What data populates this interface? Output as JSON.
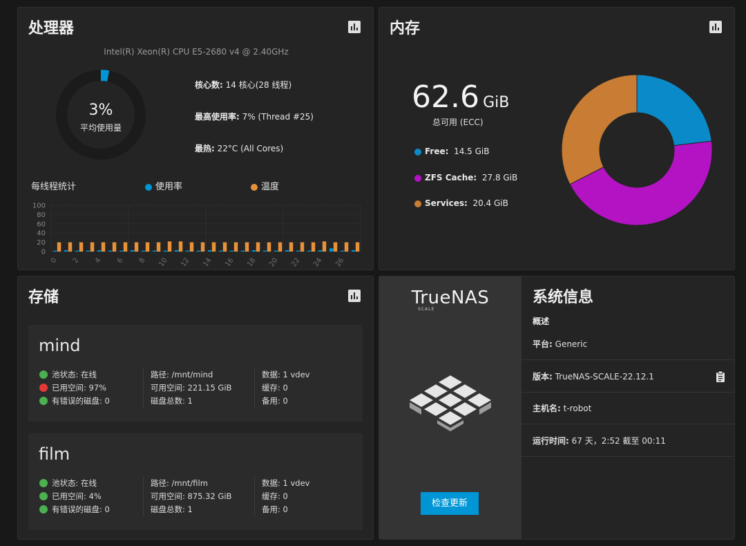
{
  "cpu": {
    "title": "处理器",
    "model": "Intel(R) Xeon(R) CPU E5-2680 v4 @ 2.40GHz",
    "avg_usage_value": "3%",
    "avg_usage_fraction": 0.03,
    "avg_usage_label": "平均使用量",
    "cores_label": "核心数:",
    "cores_value": "14 核心(28 线程)",
    "max_usage_label": "最高使用率:",
    "max_usage_value": "7%  (Thread #25)",
    "hottest_label": "最热:",
    "hottest_value": "22°C  (All Cores)",
    "thread_stats_label": "每线程统计",
    "legend_usage": "使用率",
    "legend_temp": "温度",
    "colors": {
      "usage": "#0095d5",
      "temp": "#e7923a"
    }
  },
  "chart_data": {
    "type": "bar",
    "x": [
      0,
      1,
      2,
      3,
      4,
      5,
      6,
      7,
      8,
      9,
      10,
      11,
      12,
      13,
      14,
      15,
      16,
      17,
      18,
      19,
      20,
      21,
      22,
      23,
      24,
      25,
      26,
      27
    ],
    "tick_labels": [
      "0",
      "2",
      "4",
      "6",
      "8",
      "10",
      "12",
      "14",
      "16",
      "18",
      "20",
      "22",
      "24",
      "26"
    ],
    "ylim": [
      0,
      100
    ],
    "yticks": [
      "100",
      "80",
      "60",
      "40",
      "20",
      "0"
    ],
    "series": [
      {
        "name": "使用率",
        "values": [
          2,
          3,
          2,
          2,
          3,
          2,
          2,
          3,
          2,
          2,
          2,
          3,
          2,
          2,
          3,
          2,
          2,
          2,
          3,
          2,
          2,
          3,
          2,
          2,
          3,
          7,
          2,
          3
        ]
      },
      {
        "name": "温度",
        "values": [
          20,
          20,
          20,
          20,
          20,
          20,
          20,
          20,
          20,
          20,
          22,
          22,
          20,
          20,
          20,
          20,
          20,
          20,
          20,
          20,
          20,
          20,
          20,
          20,
          22,
          20,
          20,
          20
        ]
      }
    ]
  },
  "memory": {
    "title": "内存",
    "total_number": "62.6",
    "total_unit": "GiB",
    "total_label": "总可用 (ECC)",
    "items": [
      {
        "label": "Free:",
        "value": "14.5 GiB",
        "gib": 14.5,
        "color": "#0a8ac8"
      },
      {
        "label": "ZFS Cache:",
        "value": "27.8 GiB",
        "gib": 27.8,
        "color": "#b413c4"
      },
      {
        "label": "Services:",
        "value": "20.4 GiB",
        "gib": 20.4,
        "color": "#c97c33"
      }
    ]
  },
  "storage": {
    "title": "存储",
    "pools": [
      {
        "name": "mind",
        "status_label": "池状态:",
        "status_value": "在线",
        "used_label": "已用空间:",
        "used_value": "97%",
        "errors_label": "有错误的磁盘:",
        "errors_value": "0",
        "path_label": "路径:",
        "path_value": "/mnt/mind",
        "avail_label": "可用空间:",
        "avail_value": "221.15 GiB",
        "disks_label": "磁盘总数:",
        "disks_value": "1",
        "data_label": "数据:",
        "data_value": "1 vdev",
        "cache_label": "缓存:",
        "cache_value": "0",
        "spare_label": "备用:",
        "spare_value": "0"
      },
      {
        "name": "film",
        "status_label": "池状态:",
        "status_value": "在线",
        "used_label": "已用空间:",
        "used_value": "4%",
        "errors_label": "有错误的磁盘:",
        "errors_value": "0",
        "path_label": "路径:",
        "path_value": "/mnt/film",
        "avail_label": "可用空间:",
        "avail_value": "875.32 GiB",
        "disks_label": "磁盘总数:",
        "disks_value": "1",
        "data_label": "数据:",
        "data_value": "1 vdev",
        "cache_label": "缓存:",
        "cache_value": "0",
        "spare_label": "备用:",
        "spare_value": "0"
      }
    ]
  },
  "sysinfo": {
    "logo_text": "TrueNAS",
    "logo_sub": "SCALE",
    "check_update_label": "检查更新",
    "title": "系统信息",
    "overview_label": "概述",
    "platform_label": "平台:",
    "platform_value": "Generic",
    "version_label": "版本:",
    "version_value": "TrueNAS-SCALE-22.12.1",
    "hostname_label": "主机名:",
    "hostname_value": "t-robot",
    "uptime_label": "运行时间:",
    "uptime_value": "67 天，2:52 截至 00:11",
    "accent": "#0095d5"
  }
}
